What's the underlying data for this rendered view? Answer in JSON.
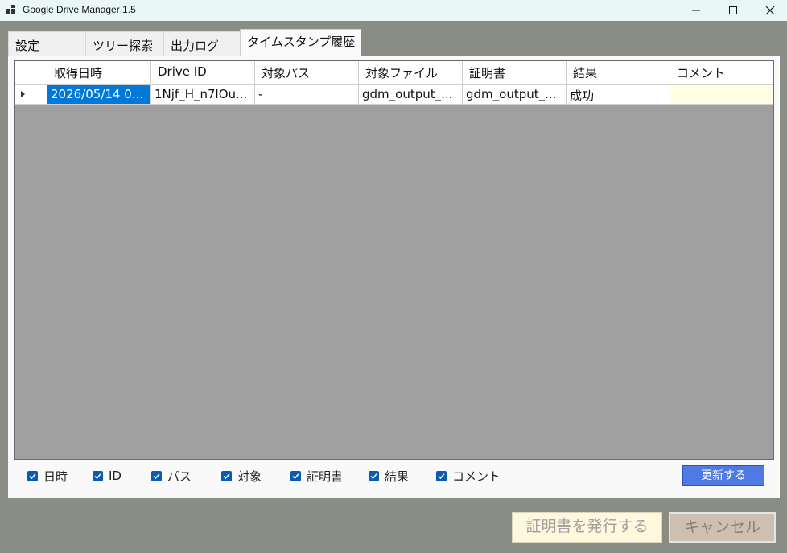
{
  "window": {
    "title": "Google Drive Manager 1.5",
    "icons": {
      "app": "app-grid-icon",
      "minimize": "minimize-icon",
      "maximize": "maximize-icon",
      "close": "close-icon"
    }
  },
  "tabs": [
    {
      "label": "設定",
      "active": false
    },
    {
      "label": "ツリー探索",
      "active": false
    },
    {
      "label": "出力ログ",
      "active": false
    },
    {
      "label": "タイムスタンプ履歴",
      "active": true
    }
  ],
  "grid": {
    "columns": [
      "取得日時",
      "Drive ID",
      "対象パス",
      "対象ファイル",
      "証明書",
      "結果",
      "コメント"
    ],
    "rows": [
      {
        "cells": [
          "2026/05/14 0...",
          "1Njf_H_n7lOu...",
          "-",
          "gdm_output_...",
          "gdm_output_...",
          "成功",
          ""
        ],
        "selected_cell": 0
      }
    ]
  },
  "filters": [
    {
      "label": "日時",
      "checked": true
    },
    {
      "label": "ID",
      "checked": true
    },
    {
      "label": "パス",
      "checked": true
    },
    {
      "label": "対象",
      "checked": true
    },
    {
      "label": "証明書",
      "checked": true
    },
    {
      "label": "結果",
      "checked": true
    },
    {
      "label": "コメント",
      "checked": true
    }
  ],
  "buttons": {
    "refresh": "更新する",
    "issue_certificate": "証明書を発行する",
    "cancel": "キャンセル"
  },
  "colors": {
    "accent": "#0078d7",
    "refresh_button": "#4f79e3",
    "comment_cell": "#fffde3",
    "grid_background": "#a0a0a0"
  }
}
